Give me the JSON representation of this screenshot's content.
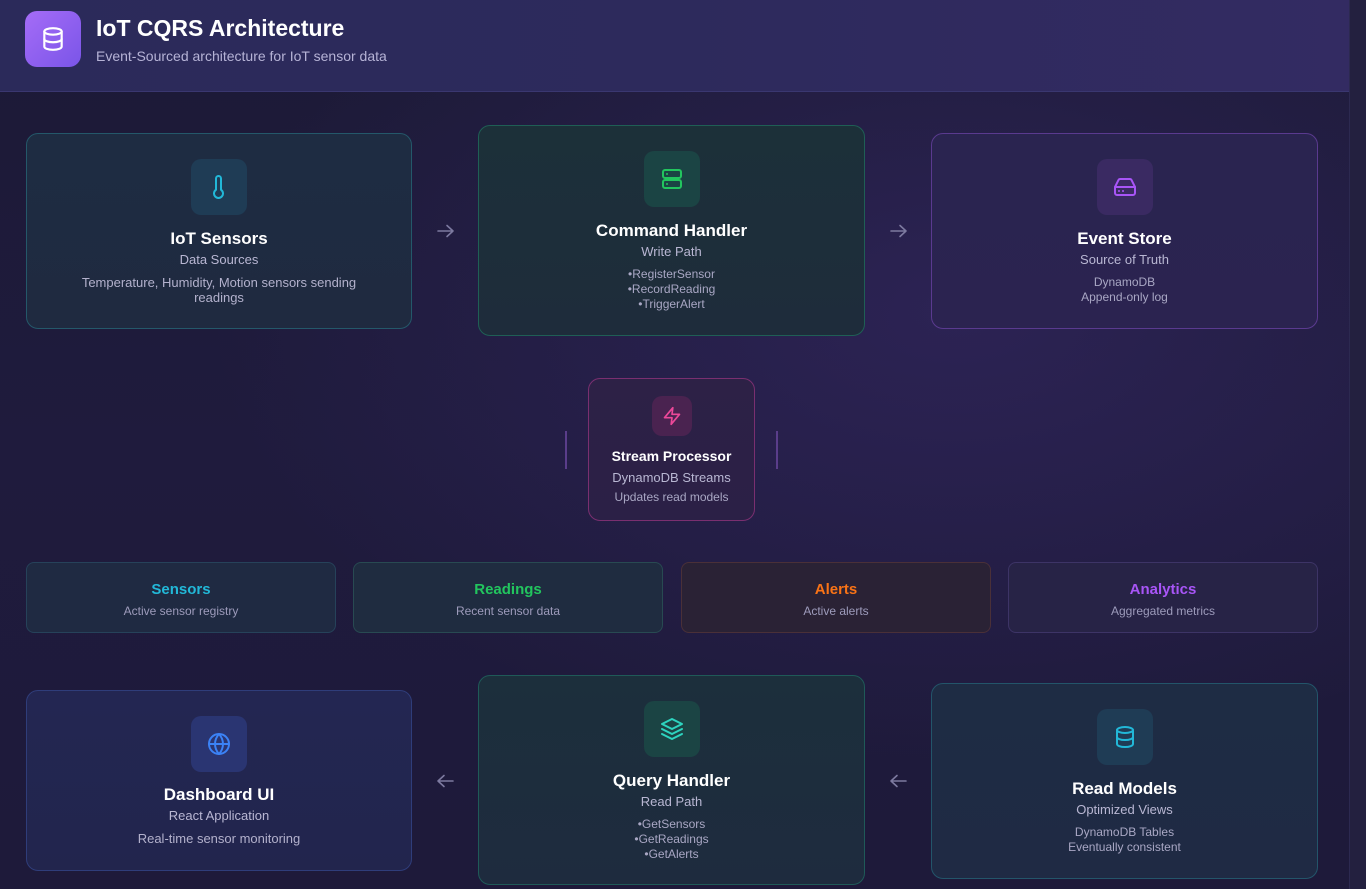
{
  "header": {
    "title": "IoT CQRS Architecture",
    "subtitle": "Event-Sourced architecture for IoT sensor data",
    "logo_icon": "database-icon"
  },
  "nodes": {
    "iot_sensors": {
      "icon": "thermometer-icon",
      "title": "IoT Sensors",
      "subtitle": "Data Sources",
      "description": "Temperature, Humidity, Motion sensors sending readings"
    },
    "command_handler": {
      "icon": "server-icon",
      "title": "Command Handler",
      "subtitle": "Write Path",
      "items": [
        "RegisterSensor",
        "RecordReading",
        "TriggerAlert"
      ]
    },
    "event_store": {
      "icon": "hard-drive-icon",
      "title": "Event Store",
      "subtitle": "Source of Truth",
      "line1": "DynamoDB",
      "line2": "Append-only log"
    },
    "stream_processor": {
      "icon": "lightning-icon",
      "title": "Stream Processor",
      "subtitle": "DynamoDB Streams",
      "description": "Updates read models"
    },
    "dashboard_ui": {
      "icon": "globe-icon",
      "title": "Dashboard UI",
      "subtitle": "React Application",
      "description": "Real-time sensor monitoring"
    },
    "query_handler": {
      "icon": "layers-icon",
      "title": "Query Handler",
      "subtitle": "Read Path",
      "items": [
        "GetSensors",
        "GetReadings",
        "GetAlerts"
      ]
    },
    "read_models": {
      "icon": "database-icon",
      "title": "Read Models",
      "subtitle": "Optimized Views",
      "line1": "DynamoDB Tables",
      "line2": "Eventually consistent"
    }
  },
  "read_model_tables": [
    {
      "title": "Sensors",
      "subtitle": "Active sensor registry",
      "color": "#22b8d8"
    },
    {
      "title": "Readings",
      "subtitle": "Recent sensor data",
      "color": "#22c55e"
    },
    {
      "title": "Alerts",
      "subtitle": "Active alerts",
      "color": "#f97316"
    },
    {
      "title": "Analytics",
      "subtitle": "Aggregated metrics",
      "color": "#a855f7"
    }
  ],
  "connectors": {
    "sensors_to_command": "arrow-right-icon",
    "command_to_event": "arrow-right-icon",
    "query_to_dashboard": "arrow-left-icon",
    "read_to_query": "arrow-left-icon"
  },
  "colors": {
    "cyan": "#22b8d8",
    "green": "#22c55e",
    "purple": "#a855f7",
    "pink": "#ec4899",
    "blue": "#3b82f6",
    "orange": "#f97316"
  }
}
